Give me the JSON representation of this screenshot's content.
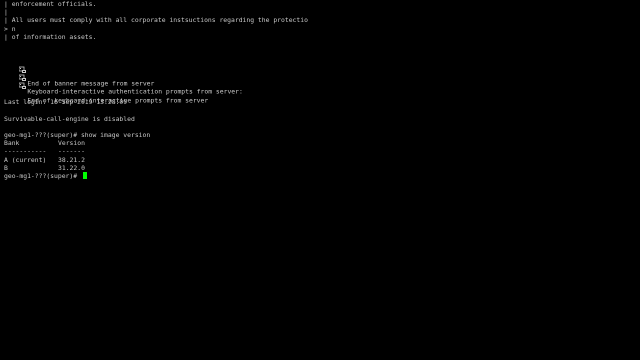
{
  "terminal": {
    "lines": {
      "l1": "| enforcement officials.",
      "l2": "|",
      "l3": "| All users must comply with all corporate instsuctions regarding the protectio",
      "l4": "> n",
      "l5": "| of information assets.",
      "banner_end": "End of banner message from server",
      "kbd_auth": "Keyboard-interactive authentication prompts from server:",
      "kbd_end": "End of keyboard-interactive prompts from server",
      "last_login": "Last login: 16-Sep-2019 13:28:09",
      "survivable": "Survivable-call-engine is disabled",
      "command": "geo-mg1-???(super)# show image version",
      "prompt": "geo-mg1-???(super)# "
    },
    "table": {
      "header_bank": "Bank",
      "header_version": "Version",
      "sep_bank": "-----------",
      "sep_version": "-------",
      "rows": [
        {
          "bank": "A (current)",
          "version": "38.21.2"
        },
        {
          "bank": "B",
          "version": "31.22.0"
        }
      ]
    },
    "icons": {
      "banner_icon": "server-prompt-icon",
      "cursor_color": "#00ff00",
      "text_color": "#c8c8c8",
      "background": "#000000"
    }
  }
}
